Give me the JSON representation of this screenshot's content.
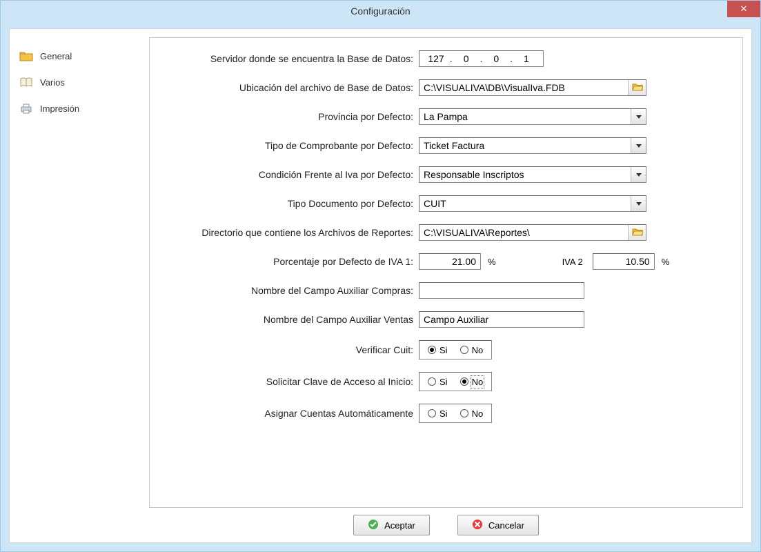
{
  "window": {
    "title": "Configuración"
  },
  "sidebar": {
    "items": [
      {
        "label": "General"
      },
      {
        "label": "Varios"
      },
      {
        "label": "Impresión"
      }
    ]
  },
  "form": {
    "server_label": "Servidor donde se encuentra la Base de Datos:",
    "server_ip": {
      "a": "127",
      "b": "0",
      "c": "0",
      "d": "1"
    },
    "dbfile_label": "Ubicación del archivo de Base de Datos:",
    "dbfile_value": "C:\\VISUALIVA\\DB\\VisualIva.FDB",
    "province_label": "Provincia por Defecto:",
    "province_value": "La Pampa",
    "voucher_label": "Tipo de Comprobante por Defecto:",
    "voucher_value": "Ticket Factura",
    "iva_cond_label": "Condición Frente al Iva por Defecto:",
    "iva_cond_value": "Responsable Inscriptos",
    "doctype_label": "Tipo Documento por Defecto:",
    "doctype_value": "CUIT",
    "reportsdir_label": "Directorio que contiene los Archivos de Reportes:",
    "reportsdir_value": "C:\\VISUALIVA\\Reportes\\",
    "iva1_label": "Porcentaje por Defecto de IVA 1:",
    "iva1_value": "21.00",
    "iva2_label": "IVA 2",
    "iva2_value": "10.50",
    "pct_symbol": "%",
    "aux_compras_label": "Nombre del Campo Auxiliar Compras:",
    "aux_compras_value": "",
    "aux_ventas_label": "Nombre del Campo Auxiliar Ventas",
    "aux_ventas_value": "Campo Auxiliar",
    "verify_cuit_label": "Verificar Cuit:",
    "ask_password_label": "Solicitar Clave de Acceso al Inicio:",
    "auto_accounts_label": "Asignar Cuentas Automáticamente",
    "opt_si": "Si",
    "opt_no": "No",
    "verify_cuit_value": "Si",
    "ask_password_value": "No",
    "auto_accounts_value": ""
  },
  "buttons": {
    "accept": "Aceptar",
    "cancel": "Cancelar"
  }
}
